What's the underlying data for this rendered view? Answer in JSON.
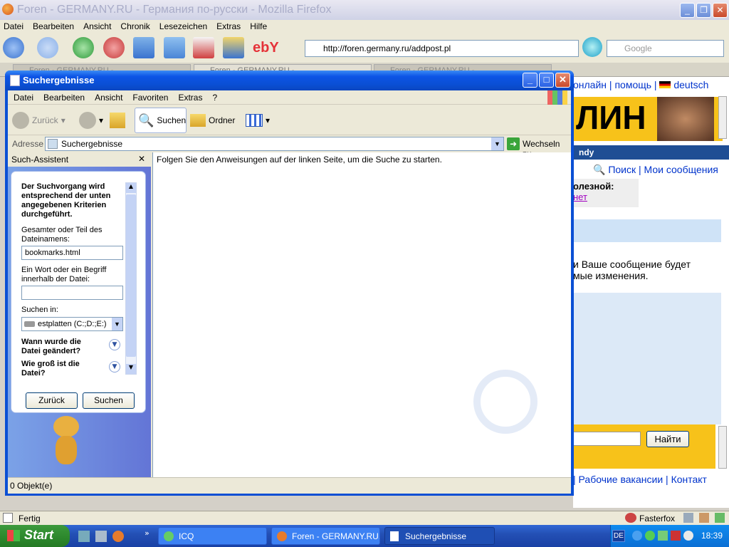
{
  "firefox": {
    "title": "Foren - GERMANY.RU - Германия по-русски - Mozilla Firefox",
    "menu": [
      "Datei",
      "Bearbeiten",
      "Ansicht",
      "Chronik",
      "Lesezeichen",
      "Extras",
      "Hilfe"
    ],
    "url": "http://foren.germany.ru/addpost.pl",
    "search_placeholder": "Google",
    "tabs": [
      "Foren - GERMANY.RU - ...",
      "Foren - GERMANY.RU - ...",
      "Foren - GERMANY.RU - ..."
    ],
    "status": "Fertig",
    "fasterfox": "Fasterfox"
  },
  "page_behind": {
    "links": [
      "онлайн",
      "помощь",
      "deutsch"
    ],
    "banner": "ЛИН",
    "user_fragment": "ndy",
    "search_link": "Поиск",
    "messages_link": "Мои сообщения",
    "useful": "олезной:",
    "net": "нет",
    "notice_line1": "и Ваше сообщение будет",
    "notice_line2": "мые изменения.",
    "find_button": "Найти",
    "footer": [
      "Рабочие вакансии",
      "Контакт"
    ]
  },
  "explorer": {
    "title": "Suchergebnisse",
    "menu": [
      "Datei",
      "Bearbeiten",
      "Ansicht",
      "Favoriten",
      "Extras",
      "?"
    ],
    "toolbar": {
      "back": "Zurück",
      "search": "Suchen",
      "folders": "Ordner"
    },
    "address_label": "Adresse",
    "address_value": "Suchergebnisse",
    "go_label": "Wechseln zu",
    "assistant_title": "Such-Assistent",
    "criteria_text": "Der Suchvorgang wird entsprechend der unten angegebenen Kriterien durchgeführt.",
    "filename_label": "Gesamter oder Teil des Dateinamens:",
    "filename_value": "bookmarks.html",
    "word_label": "Ein Wort oder ein Begriff innerhalb der Datei:",
    "word_value": "",
    "search_in_label": "Suchen in:",
    "search_in_value": "estplatten (C:;D:;E:)",
    "when_modified": "Wann wurde die Datei geändert?",
    "size_label": "Wie groß ist die Datei?",
    "back_button": "Zurück",
    "search_button": "Suchen",
    "main_text": "Folgen Sie den Anweisungen auf der linken Seite, um die Suche zu starten.",
    "status": "0 Objekt(e)"
  },
  "taskbar": {
    "start": "Start",
    "items": [
      "ICQ",
      "Foren - GERMANY.RU...",
      "Suchergebnisse"
    ],
    "lang": "DE",
    "time": "18:39"
  }
}
